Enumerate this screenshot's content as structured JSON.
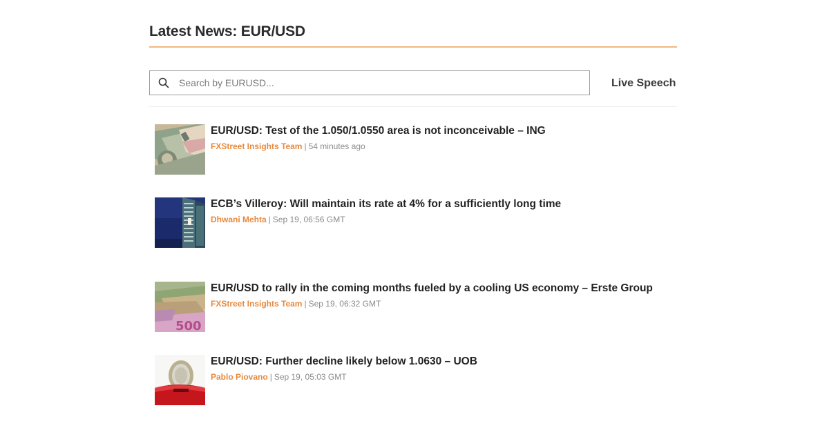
{
  "section": {
    "title": "Latest News: EUR/USD",
    "accent_color": "#f2b783"
  },
  "search": {
    "placeholder": "Search by EURUSD...",
    "value": "",
    "icon": "search-icon"
  },
  "live_speech": {
    "label": "Live Speech"
  },
  "news": [
    {
      "headline": "EUR/USD: Test of the 1.050/1.0550 area is not inconceivable – ING",
      "author": "FXStreet Insights Team",
      "separator": "|",
      "time": "54 minutes ago",
      "thumbnail": "banknotes-dollar-image"
    },
    {
      "headline": "ECB’s Villeroy: Will maintain its rate at 4% for a sufficiently long time",
      "author": "Dhwani Mehta",
      "separator": "|",
      "time": "Sep 19, 06:56 GMT",
      "thumbnail": "ecb-building-image"
    },
    {
      "headline": "EUR/USD to rally in the coming months fueled by a cooling US economy – Erste Group",
      "author": "FXStreet Insights Team",
      "separator": "|",
      "time": "Sep 19, 06:32 GMT",
      "thumbnail": "euro-banknotes-image"
    },
    {
      "headline": "EUR/USD: Further decline likely below 1.0630 – UOB",
      "author": "Pablo Piovano",
      "separator": "|",
      "time": "Sep 19, 05:03 GMT",
      "thumbnail": "euro-coin-image"
    }
  ],
  "colors": {
    "author": "#e8893d",
    "meta": "#8a8a8a",
    "headline": "#222222"
  }
}
